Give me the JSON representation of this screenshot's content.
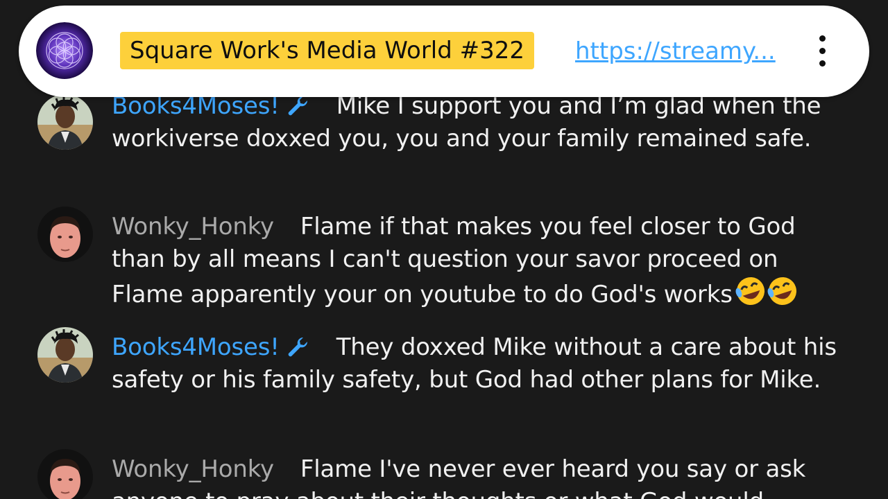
{
  "banner": {
    "avatar_icon": "sacred-geometry-avatar-icon",
    "title": "Square Work's Media World #322",
    "link_text": "https://streamy...",
    "menu_icon": "more-vertical-icon",
    "title_highlight_color": "#fdd03b",
    "link_color": "#3ea6ff"
  },
  "colors": {
    "background": "#1a1a1a",
    "moderator_name": "#3ea6ff",
    "viewer_name": "#aaaaaa",
    "message_text": "#f1f1f1"
  },
  "messages": [
    {
      "author": "Books4Moses!",
      "author_role": "moderator",
      "badge_icon": "wrench-icon",
      "text": "Mike I support you and I’m glad when the workiverse doxxed you, you and your family remained safe.",
      "emoji": ""
    },
    {
      "author": "Wonky_Honky",
      "author_role": "viewer",
      "badge_icon": "",
      "text": "Flame if that makes you feel closer to God than by all means I can't question your savor proceed on Flame apparently your on youtube to do God's works",
      "emoji": "rolling-on-floor-laughing-emoji x2"
    },
    {
      "author": "Books4Moses!",
      "author_role": "moderator",
      "badge_icon": "wrench-icon",
      "text": "They doxxed Mike without a care about his safety or his family safety, but God had other plans for Mike.",
      "emoji": ""
    },
    {
      "author": "Wonky_Honky",
      "author_role": "viewer",
      "badge_icon": "",
      "text": "Flame I've never ever heard you say or ask anyone to pray about their thoughts or what God would",
      "emoji": ""
    }
  ]
}
